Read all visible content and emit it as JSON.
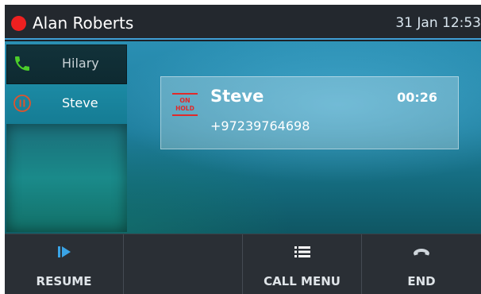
{
  "status_bar": {
    "user_name": "Alan Roberts",
    "datetime": "31 Jan 12:53",
    "presence_color": "#ee2020"
  },
  "calls": [
    {
      "name": "Hilary",
      "state": "active",
      "icon": "phone-icon",
      "icon_color": "#4ccd2a"
    },
    {
      "name": "Steve",
      "state": "on-hold",
      "icon": "pause-circle-icon",
      "icon_color": "#e0532c"
    }
  ],
  "call_card": {
    "badge_line1": "ON",
    "badge_line2": "HOLD",
    "name": "Steve",
    "number": "+97239764698",
    "duration": "00:26"
  },
  "softkeys": [
    {
      "label": "RESUME",
      "icon": "resume-icon"
    },
    {
      "label": "",
      "icon": ""
    },
    {
      "label": "CALL MENU",
      "icon": "menu-list-icon"
    },
    {
      "label": "END",
      "icon": "end-call-icon"
    }
  ],
  "colors": {
    "accent": "#3f9fd6",
    "hold_red": "#e02a2a"
  }
}
